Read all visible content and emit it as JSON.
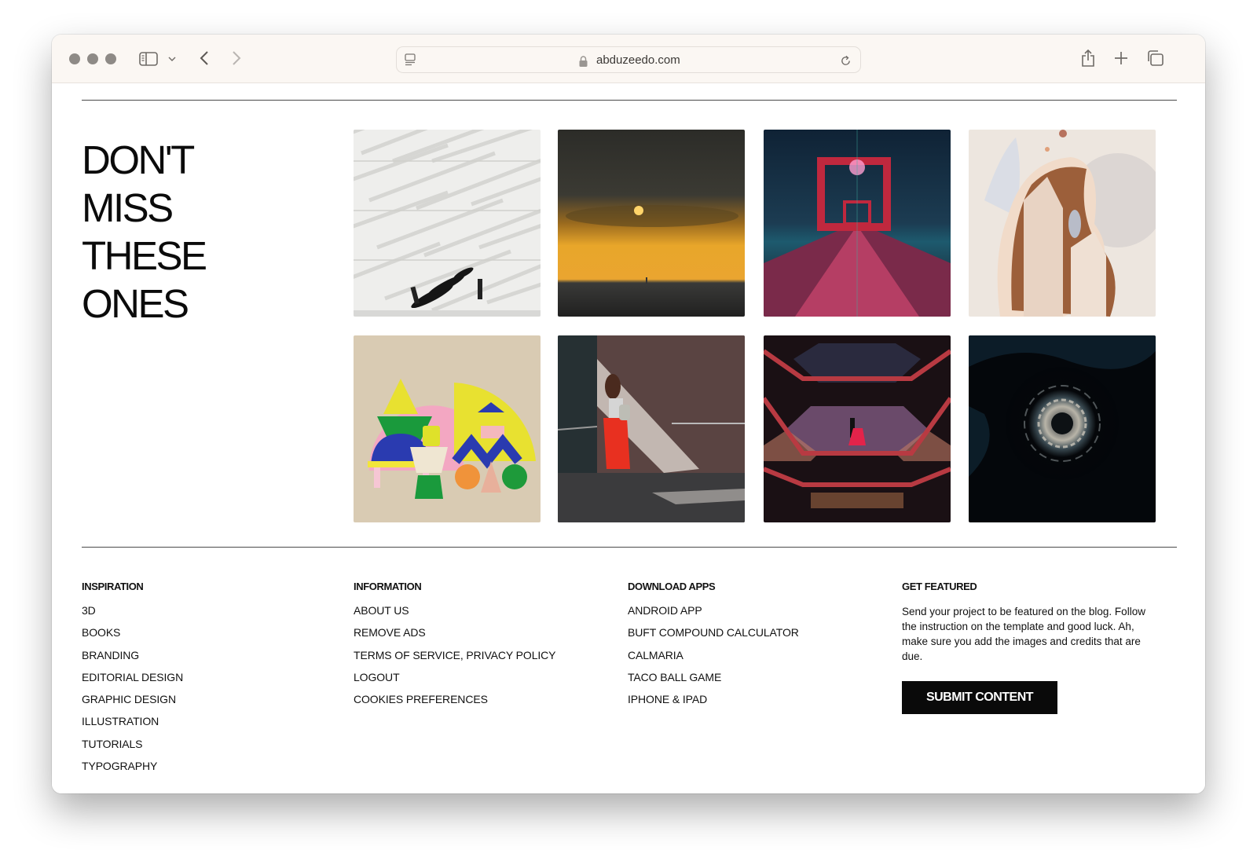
{
  "browser": {
    "url": "abduzeedo.com",
    "icons": {
      "traffic_lights": [
        "close-dot",
        "minimize-dot",
        "zoom-dot"
      ],
      "sidebar": "sidebar-icon",
      "sidebar_menu": "chevron-down-icon",
      "back": "chevron-left-icon",
      "forward": "chevron-right-icon",
      "page_menu": "page-menu-icon",
      "lock": "lock-icon",
      "reload": "reload-icon",
      "share": "share-icon",
      "new_tab": "plus-icon",
      "tab_overview": "tabs-icon"
    }
  },
  "gallery": {
    "headline": [
      "DON'T",
      "MISS",
      "THESE",
      "ONES"
    ],
    "items": [
      {
        "subject": "white wavy building facade with two people"
      },
      {
        "subject": "sunset over sea with dark clouds"
      },
      {
        "subject": "red illuminated bridge gates at night"
      },
      {
        "subject": "abstract illustration of woman with brown hair"
      },
      {
        "subject": "colorful 3D still life shapes"
      },
      {
        "subject": "woman in red pants in tiled corridor"
      },
      {
        "subject": "symmetrical architecture with couple at dusk"
      },
      {
        "subject": "dark abstract swirl"
      }
    ]
  },
  "footer": {
    "inspiration": {
      "title": "INSPIRATION",
      "links": [
        "3D",
        "BOOKS",
        "BRANDING",
        "EDITORIAL DESIGN",
        "GRAPHIC DESIGN",
        "ILLUSTRATION",
        "TUTORIALS",
        "TYPOGRAPHY"
      ]
    },
    "information": {
      "title": "INFORMATION",
      "links": [
        "ABOUT US",
        "REMOVE ADS",
        "TERMS OF SERVICE, PRIVACY POLICY",
        "LOGOUT",
        "COOKIES PREFERENCES"
      ]
    },
    "download_apps": {
      "title": "DOWNLOAD APPS",
      "links": [
        "ANDROID APP",
        "BUFT COMPOUND CALCULATOR",
        "CALMARIA",
        "TACO BALL GAME",
        "IPHONE & IPAD"
      ]
    },
    "get_featured": {
      "title": "GET FEATURED",
      "text": "Send your project to be featured on the blog. Follow the instruction on the template and good luck. Ah, make sure you add the images and credits that are due.",
      "button": "SUBMIT CONTENT"
    }
  }
}
